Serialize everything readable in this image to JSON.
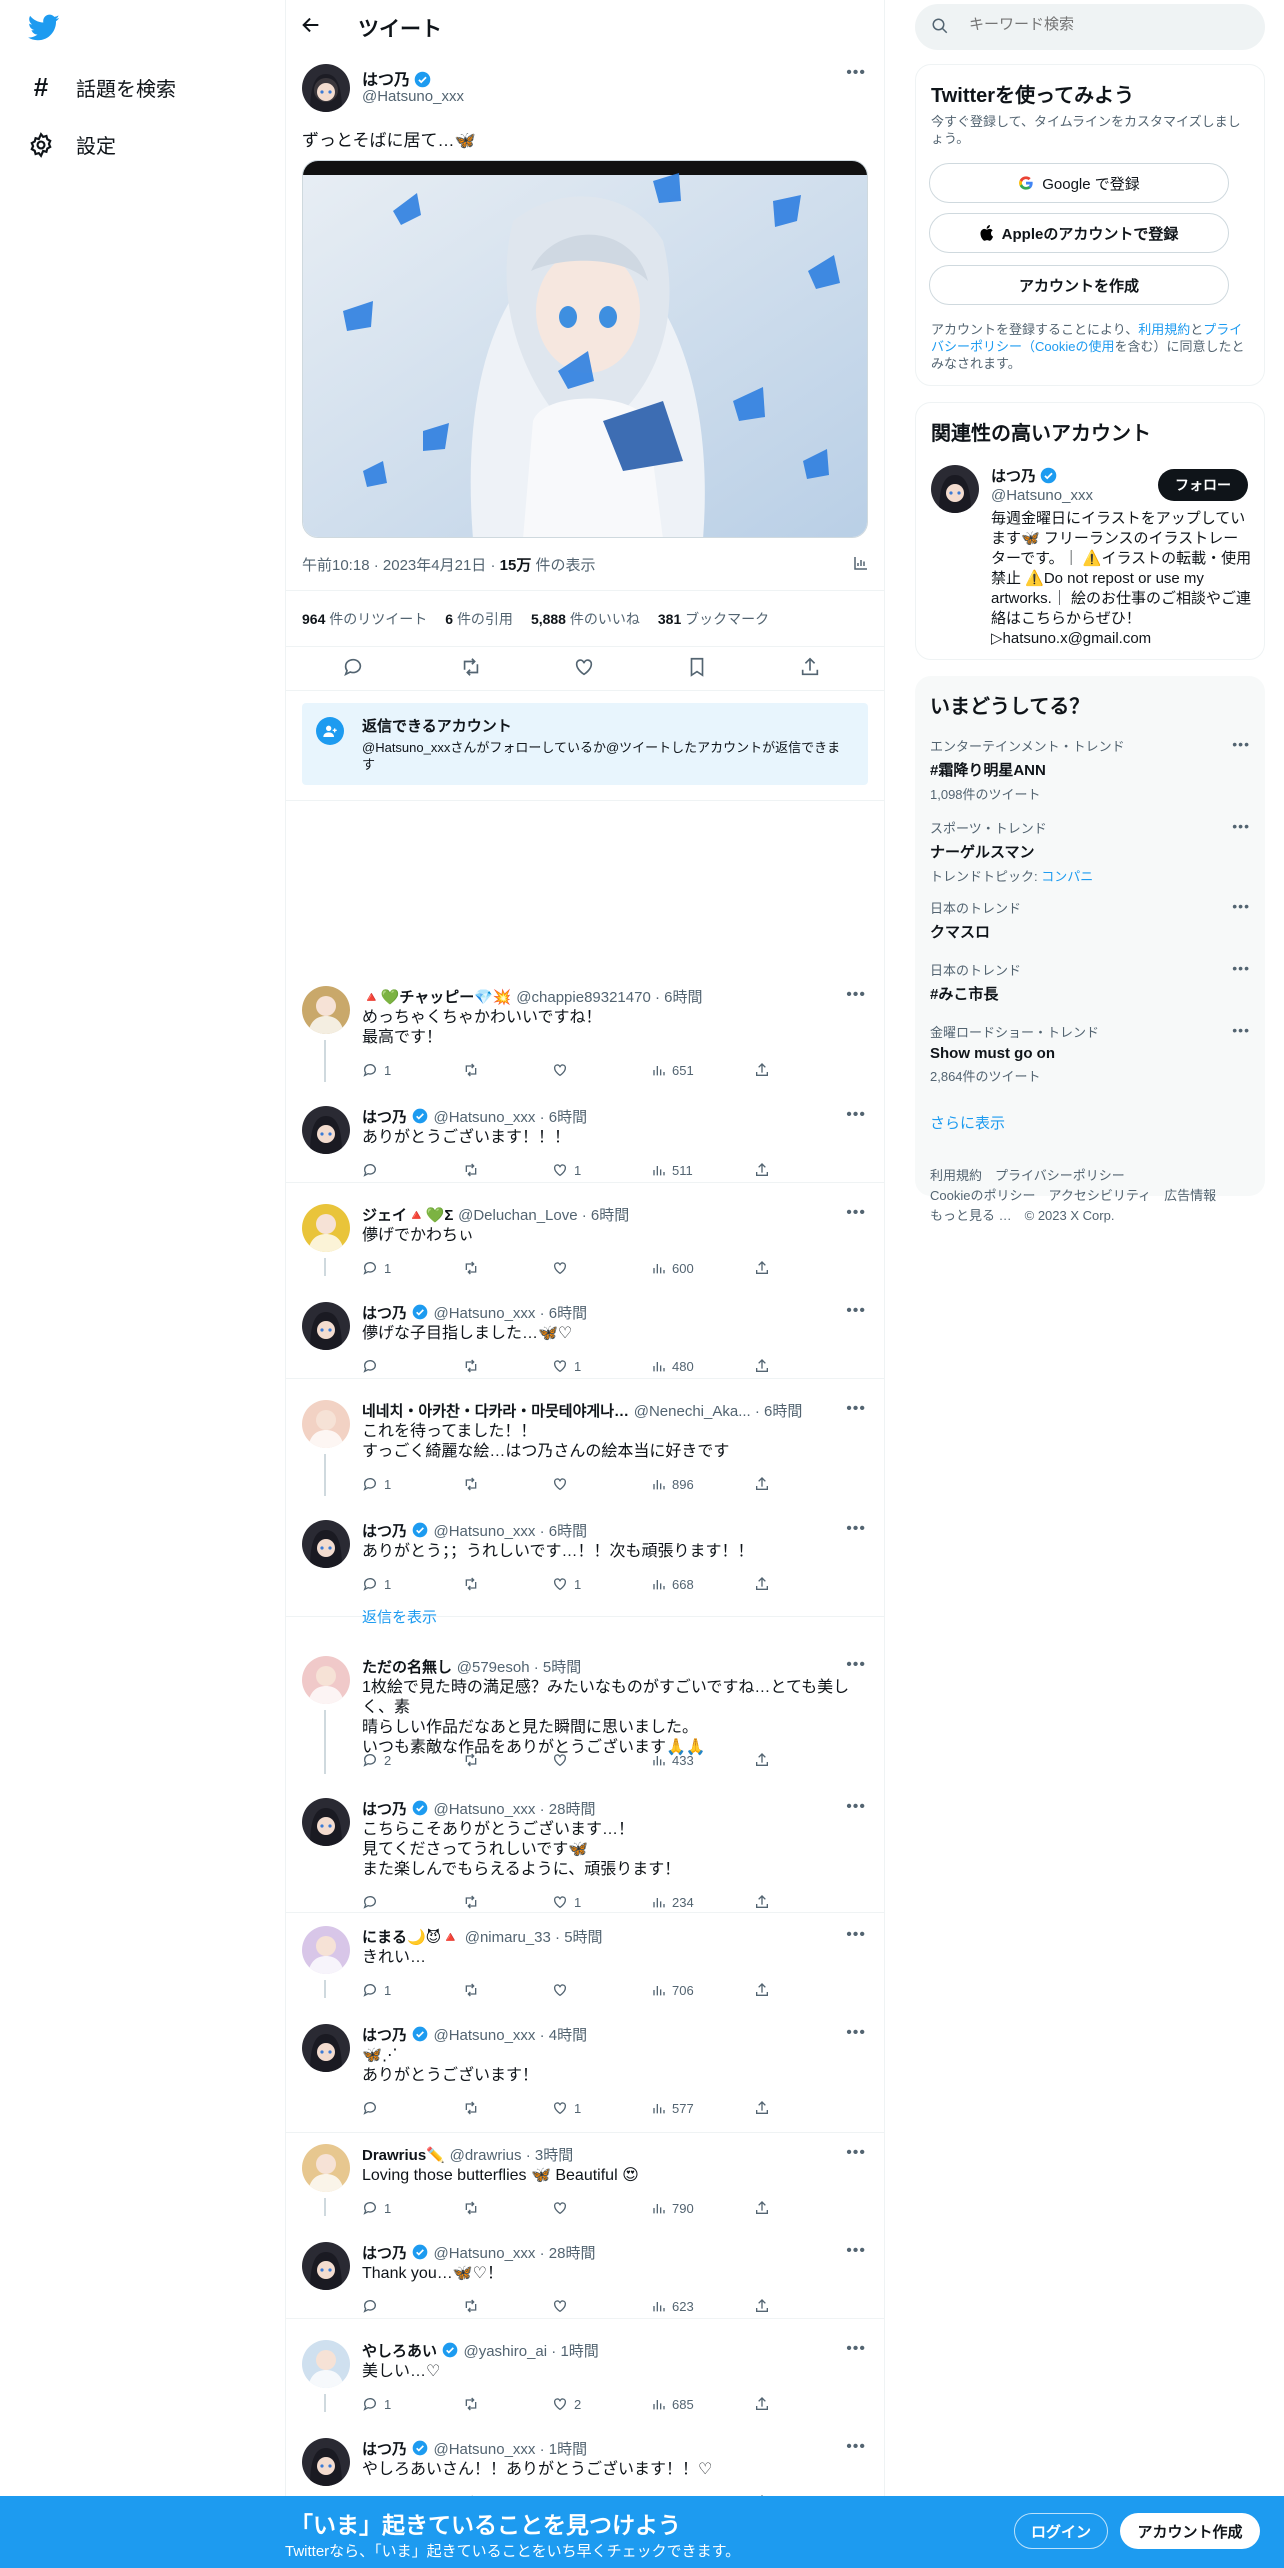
{
  "left_nav": {
    "explore_label": "話題を検索",
    "settings_label": "設定"
  },
  "header": {
    "title": "ツイート"
  },
  "main_tweet": {
    "author_name": "はつ乃",
    "author_handle": "@Hatsuno_xxx",
    "text": "ずっとそばに居て…🦋",
    "time": "午前10:18",
    "date": "2023年4月21日",
    "views_count": "15万",
    "views_label": "件の表示",
    "retweets_count": "964",
    "retweets_label": "件のリツイート",
    "quotes_count": "6",
    "quotes_label": "件の引用",
    "likes_count": "5,888",
    "likes_label": "件のいいね",
    "bookmarks_count": "381",
    "bookmarks_label": "ブックマーク"
  },
  "reply_restriction": {
    "title": "返信できるアカウント",
    "text": "@Hatsuno_xxxさんがフォローしているか@ツイートしたアカウントが返信できます"
  },
  "replies": [
    {
      "name": "🔺💚チャッピー💎💥",
      "handle": "@chappie89321470",
      "time": "6時間",
      "lines": [
        "めっちゃくちゃかわいいですね！",
        "最高です！"
      ],
      "replies": "1",
      "retweets": "",
      "likes": "",
      "views": "651",
      "verified": false
    },
    {
      "name": "はつ乃",
      "handle": "@Hatsuno_xxx",
      "time": "6時間",
      "lines": [
        "ありがとうございます！！！"
      ],
      "replies": "",
      "retweets": "",
      "likes": "1",
      "views": "511",
      "verified": true
    },
    {
      "name": "ジェイ🔺💚Σ",
      "handle": "@Deluchan_Love",
      "time": "6時間",
      "lines": [
        "儚げでかわちぃ"
      ],
      "replies": "1",
      "retweets": "",
      "likes": "",
      "views": "600",
      "verified": false
    },
    {
      "name": "はつ乃",
      "handle": "@Hatsuno_xxx",
      "time": "6時間",
      "lines": [
        "儚げな子目指しました…🦋♡"
      ],
      "replies": "",
      "retweets": "",
      "likes": "1",
      "views": "480",
      "verified": true
    },
    {
      "name": "네네치・아카찬・다카라・마뭇테야게나…",
      "handle": "@Nenechi_Aka...",
      "time": "6時間",
      "lines": [
        "これを待ってました！！",
        "すっごく綺麗な絵…はつ乃さんの絵本当に好きです"
      ],
      "replies": "1",
      "retweets": "",
      "likes": "",
      "views": "896",
      "verified": false
    },
    {
      "name": "はつ乃",
      "handle": "@Hatsuno_xxx",
      "time": "6時間",
      "lines": [
        "ありがとう；；うれしいです…！！次も頑張ります！！"
      ],
      "replies": "1",
      "retweets": "",
      "likes": "1",
      "views": "668",
      "verified": true
    },
    {
      "name": "ただの名無し",
      "handle": "@579esoh",
      "time": "5時間",
      "lines": [
        "1枚絵で見た時の満足感？みたいなものがすごいですね…とても美しく、素",
        "晴らしい作品だなあと見た瞬間に思いました。",
        "いつも素敵な作品をありがとうございます🙏🙏"
      ],
      "replies": "2",
      "retweets": "",
      "likes": "",
      "views": "433",
      "verified": false
    },
    {
      "name": "はつ乃",
      "handle": "@Hatsuno_xxx",
      "time": "28時間",
      "lines": [
        "こちらこそありがとうございます…！",
        "見てくださってうれしいです🦋",
        "また楽しんでもらえるように、頑張ります！"
      ],
      "replies": "",
      "retweets": "",
      "likes": "1",
      "views": "234",
      "verified": true
    },
    {
      "name": "にまる🌙😈🔺",
      "handle": "@nimaru_33",
      "time": "5時間",
      "lines": [
        "きれい…"
      ],
      "replies": "1",
      "retweets": "",
      "likes": "",
      "views": "706",
      "verified": false
    },
    {
      "name": "はつ乃",
      "handle": "@Hatsuno_xxx",
      "time": "4時間",
      "lines": [
        "🦋⋰",
        "ありがとうございます！"
      ],
      "replies": "",
      "retweets": "",
      "likes": "1",
      "views": "577",
      "verified": true
    },
    {
      "name": "Drawrius✏️",
      "handle": "@drawrius",
      "time": "3時間",
      "lines": [
        "Loving those butterflies 🦋 Beautiful 😍"
      ],
      "replies": "1",
      "retweets": "",
      "likes": "",
      "views": "790",
      "verified": false
    },
    {
      "name": "はつ乃",
      "handle": "@Hatsuno_xxx",
      "time": "28時間",
      "lines": [
        "Thank you…🦋♡！"
      ],
      "replies": "",
      "retweets": "",
      "likes": "",
      "views": "623",
      "verified": true
    },
    {
      "name": "やしろあい",
      "handle": "@yashiro_ai",
      "time": "1時間",
      "lines": [
        "美しい…♡"
      ],
      "replies": "1",
      "retweets": "",
      "likes": "2",
      "views": "685",
      "verified": true
    },
    {
      "name": "はつ乃",
      "handle": "@Hatsuno_xxx",
      "time": "1時間",
      "lines": [
        "やしろあいさん！！ありがとうございます！！♡"
      ],
      "replies": "",
      "retweets": "",
      "likes": "",
      "views": "",
      "verified": true
    }
  ],
  "show_replies_label": "返信を表示",
  "search": {
    "placeholder": "キーワード検索"
  },
  "signup": {
    "title": "Twitterを使ってみよう",
    "subtitle": "今すぐ登録して、タイムラインをカスタマイズしましょう。",
    "google_label": "Google で登録",
    "apple_label": "Appleのアカウントで登録",
    "create_label": "アカウントを作成",
    "terms_prefix": "アカウントを登録することにより、",
    "terms_link1": "利用規約",
    "terms_and": "と",
    "terms_link2": "プライバシーポリシー（Cookieの使用",
    "terms_suffix": "を含む）に同意したとみなされます。"
  },
  "related": {
    "title": "関連性の高いアカウント",
    "name": "はつ乃",
    "handle": "@Hatsuno_xxx",
    "follow_label": "フォロー",
    "bio": "毎週金曜日にイラストをアップしています🦋 フリーランスのイラストレーターです。｜ ⚠️イラストの転載・使用禁止 ⚠️Do not repost or use my artworks.｜ 絵のお仕事のご相談やご連絡はこちらからぜひ！ ▷hatsuno.x@gmail.com"
  },
  "trends": {
    "title": "いまどうしてる？",
    "items": [
      {
        "context": "エンターテインメント・トレンド",
        "name": "#霜降り明星ANN",
        "sub": "1,098件のツイート"
      },
      {
        "context": "スポーツ・トレンド",
        "name": "ナーゲルスマン",
        "sub": "トレンドトピック: ",
        "sub_link": "コンパニ"
      },
      {
        "context": "日本のトレンド",
        "name": "クマスロ",
        "sub": ""
      },
      {
        "context": "日本のトレンド",
        "name": "#みこ市長",
        "sub": ""
      },
      {
        "context": "金曜ロードショー・トレンド",
        "name": "Show must go on",
        "sub": "2,864件のツイート"
      }
    ],
    "show_more": "さらに表示"
  },
  "footer": {
    "links_row1": [
      "利用規約",
      "プライバシーポリシー"
    ],
    "links_row2": [
      "Cookieのポリシー",
      "アクセシビリティ",
      "広告情報"
    ],
    "more": "もっと見る …",
    "copyright": "© 2023 X Corp."
  },
  "banner": {
    "title": "「いま」起きていることを見つけよう",
    "subtitle": "Twitterなら、「いま」起きていることをいち早くチェックできます。",
    "login_label": "ログイン",
    "signup_label": "アカウント作成"
  },
  "colors": {
    "accent": "#1d9bf0",
    "text": "#0f1419",
    "muted": "#536471",
    "border": "#eff3f4"
  }
}
